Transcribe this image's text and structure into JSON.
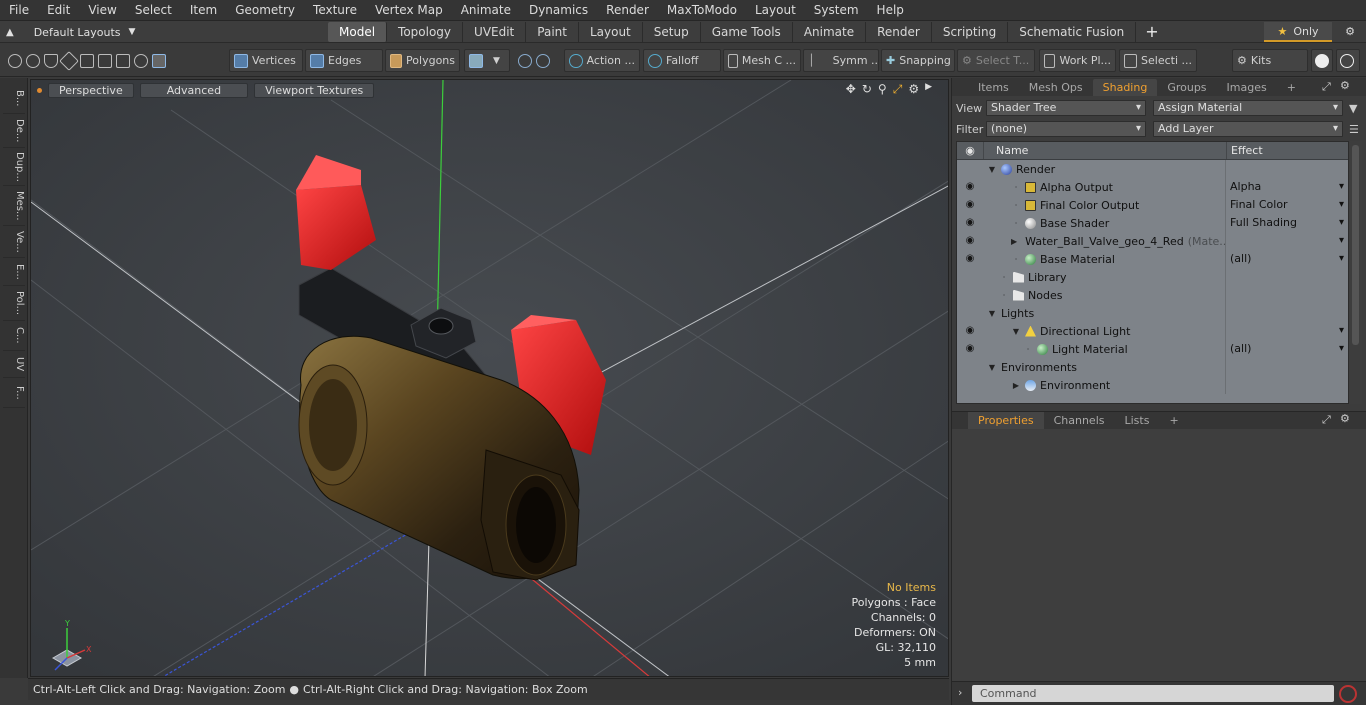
{
  "menu": [
    "File",
    "Edit",
    "View",
    "Select",
    "Item",
    "Geometry",
    "Texture",
    "Vertex Map",
    "Animate",
    "Dynamics",
    "Render",
    "MaxToModo",
    "Layout",
    "System",
    "Help"
  ],
  "layout": {
    "selector": "Default Layouts",
    "tabs": [
      "Model",
      "Topology",
      "UVEdit",
      "Paint",
      "Layout",
      "Setup",
      "Game Tools",
      "Animate",
      "Render",
      "Scripting",
      "Schematic Fusion"
    ],
    "active_tab": "Model",
    "only_label": "Only"
  },
  "toolbar": {
    "vertices": "Vertices",
    "edges": "Edges",
    "polygons": "Polygons",
    "action": "Action ...",
    "falloff": "Falloff",
    "mesh": "Mesh C ...",
    "symm": "Symm ...",
    "snapping": "Snapping",
    "select_t": "Select T...",
    "work_pl": "Work Pl...",
    "selecti": "Selecti ...",
    "kits": "Kits"
  },
  "left_strip": [
    "B...",
    "De...",
    "Dup...",
    "Mes...",
    "Ve...",
    "E...",
    "Pol...",
    "C...",
    "UV",
    "F..."
  ],
  "viewport": {
    "buttons": [
      "Perspective",
      "Advanced",
      "Viewport Textures"
    ],
    "info": {
      "no_items": "No Items",
      "polygons": "Polygons : Face",
      "channels": "Channels: 0",
      "deformers": "Deformers: ON",
      "gl": "GL: 32,110",
      "scale": "5 mm"
    },
    "axis_y": "Y",
    "axis_x": "X"
  },
  "status": {
    "left": "Ctrl-Alt-Left Click and Drag: Navigation: Zoom",
    "right": "Ctrl-Alt-Right Click and Drag: Navigation: Box Zoom"
  },
  "right_panel": {
    "tabs": [
      "Items",
      "Mesh Ops",
      "Shading",
      "Groups",
      "Images"
    ],
    "active_tab": "Shading",
    "view_label": "View",
    "view_value": "Shader Tree",
    "assign_material": "Assign Material",
    "filter_label": "Filter",
    "filter_value": "(none)",
    "add_layer": "Add Layer",
    "tree": {
      "col_name": "Name",
      "col_effect": "Effect",
      "rows": [
        {
          "name": "Render",
          "effect": "",
          "indent": 0,
          "eye": false,
          "expander": "down",
          "icon": "sphere-blue"
        },
        {
          "name": "Alpha Output",
          "effect": "Alpha",
          "indent": 2,
          "eye": true,
          "expander": "",
          "icon": "output"
        },
        {
          "name": "Final Color Output",
          "effect": "Final Color",
          "indent": 2,
          "eye": true,
          "expander": "",
          "icon": "output"
        },
        {
          "name": "Base Shader",
          "effect": "Full Shading",
          "indent": 2,
          "eye": true,
          "expander": "",
          "icon": "sphere-white"
        },
        {
          "name": "Water_Ball_Valve_geo_4_Red",
          "suffix": "(Mate...",
          "effect": "",
          "indent": 2,
          "eye": true,
          "expander": "right",
          "icon": "sphere-red"
        },
        {
          "name": "Base Material",
          "effect": "(all)",
          "indent": 2,
          "eye": true,
          "expander": "",
          "icon": "sphere-green"
        },
        {
          "name": "Library",
          "effect": "",
          "indent": 1,
          "eye": false,
          "expander": "",
          "icon": "folder"
        },
        {
          "name": "Nodes",
          "effect": "",
          "indent": 1,
          "eye": false,
          "expander": "",
          "icon": "folder"
        },
        {
          "name": "Lights",
          "effect": "",
          "indent": 0,
          "eye": false,
          "expander": "down",
          "icon": ""
        },
        {
          "name": "Directional Light",
          "effect": "",
          "indent": 2,
          "eye": true,
          "expander": "down",
          "icon": "light"
        },
        {
          "name": "Light Material",
          "effect": "(all)",
          "indent": 3,
          "eye": true,
          "expander": "",
          "icon": "sphere-green"
        },
        {
          "name": "Environments",
          "effect": "",
          "indent": 0,
          "eye": false,
          "expander": "down",
          "icon": ""
        },
        {
          "name": "Environment",
          "effect": "",
          "indent": 2,
          "eye": false,
          "expander": "right",
          "icon": "sphere-sky"
        }
      ]
    },
    "props_tabs": [
      "Properties",
      "Channels",
      "Lists"
    ],
    "props_active": "Properties",
    "command_placeholder": "Command"
  }
}
